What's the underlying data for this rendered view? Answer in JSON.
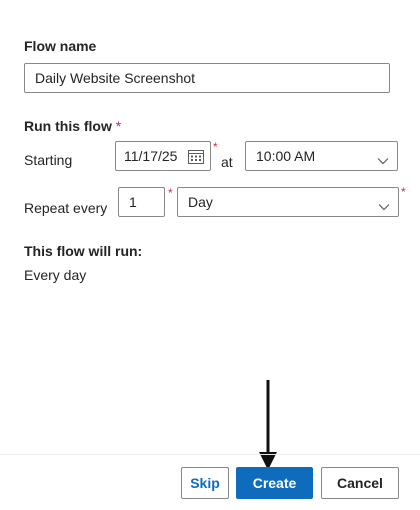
{
  "flow_name": {
    "label": "Flow name",
    "value": "Daily Website Screenshot"
  },
  "schedule": {
    "label": "Run this flow",
    "required_mark": "*",
    "starting_label": "Starting",
    "date_value": "11/17/25",
    "at_label": "at",
    "time_value": "10:00 AM",
    "repeat_label": "Repeat every",
    "interval_value": "1",
    "unit_value": "Day"
  },
  "summary": {
    "heading": "This flow will run:",
    "text": "Every day"
  },
  "footer": {
    "skip_label": "Skip",
    "create_label": "Create",
    "cancel_label": "Cancel"
  },
  "colors": {
    "accent": "#0f6cbd",
    "required": "#c4314b",
    "border": "#8a8886",
    "arrow": "#111111"
  },
  "icons": {
    "date_picker": "calendar-icon",
    "dropdown": "chevron-down-icon",
    "annotation": "arrow-down"
  }
}
